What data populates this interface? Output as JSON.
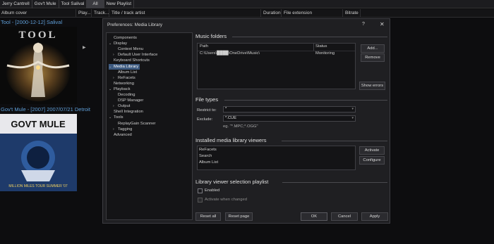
{
  "tabs": [
    "Jerry Cantrell",
    "Gov't Mule",
    "Tool Salival",
    "All",
    "New Playlist"
  ],
  "columns": [
    "Album cover",
    "Play...",
    "Track...",
    "Title / track artist",
    "Duration",
    "File extension",
    "Bitrate"
  ],
  "groups": [
    {
      "title": "Tool - [2000-12-12] Salival",
      "art_text": "TOOL"
    },
    {
      "title": "Gov't Mule - [2007] 2007/07/21 Detroit",
      "art_text": "GOVT MULE",
      "art_sub": "MILLION MILES TOUR SUMMER '07"
    }
  ],
  "dialog": {
    "title": "Preferences: Media Library",
    "help": "?",
    "close": "✕",
    "tree": [
      {
        "label": "Components",
        "level": 0,
        "arrow": ""
      },
      {
        "label": "Display",
        "level": 0,
        "arrow": "⌄"
      },
      {
        "label": "Context Menu",
        "level": 1,
        "arrow": ""
      },
      {
        "label": "Default User Interface",
        "level": 1,
        "arrow": "›"
      },
      {
        "label": "Keyboard Shortcuts",
        "level": 0,
        "arrow": ""
      },
      {
        "label": "Media Library",
        "level": 0,
        "arrow": "⌄",
        "selected": true
      },
      {
        "label": "Album List",
        "level": 1,
        "arrow": ""
      },
      {
        "label": "ReFacets",
        "level": 1,
        "arrow": "›"
      },
      {
        "label": "Networking",
        "level": 0,
        "arrow": ""
      },
      {
        "label": "Playback",
        "level": 0,
        "arrow": "⌄"
      },
      {
        "label": "Decoding",
        "level": 1,
        "arrow": ""
      },
      {
        "label": "DSP Manager",
        "level": 1,
        "arrow": ""
      },
      {
        "label": "Output",
        "level": 1,
        "arrow": "›"
      },
      {
        "label": "Shell Integration",
        "level": 0,
        "arrow": ""
      },
      {
        "label": "Tools",
        "level": 0,
        "arrow": "⌄"
      },
      {
        "label": "ReplayGain Scanner",
        "level": 1,
        "arrow": ""
      },
      {
        "label": "Tagging",
        "level": 1,
        "arrow": "›"
      },
      {
        "label": "Advanced",
        "level": 0,
        "arrow": ""
      }
    ],
    "music_folders": {
      "heading": "Music folders",
      "col_path": "Path",
      "col_status": "Status",
      "rows": [
        {
          "path": "C:\\Users\\████\\OneDrive\\Music\\",
          "status": "Monitoring"
        }
      ],
      "add": "Add...",
      "remove": "Remove",
      "show_errors": "Show errors"
    },
    "file_types": {
      "heading": "File types",
      "restrict_label": "Restrict to:",
      "restrict_value": "*",
      "exclude_label": "Exclude:",
      "exclude_value": "*.CUE",
      "hint": "eg. \"*.MPC;*.OGG\""
    },
    "viewers": {
      "heading": "Installed media library viewers",
      "items": [
        "ReFacets",
        "Search",
        "Album List"
      ],
      "activate": "Activate",
      "configure": "Configure"
    },
    "playlist": {
      "heading": "Library viewer selection playlist",
      "enabled": "Enabled",
      "activate_changed": "Activate when changed"
    },
    "buttons": {
      "reset_all": "Reset all",
      "reset_page": "Reset page",
      "ok": "OK",
      "cancel": "Cancel",
      "apply": "Apply"
    }
  }
}
